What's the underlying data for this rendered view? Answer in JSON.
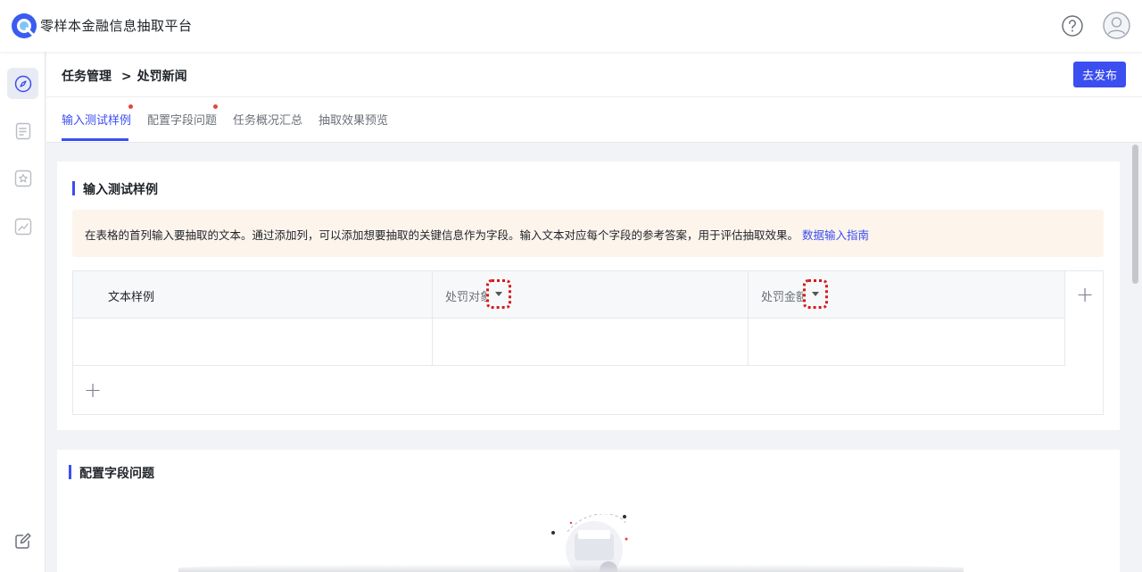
{
  "app": {
    "title": "零样本金融信息抽取平台"
  },
  "header": {
    "breadcrumb_parent": "任务管理",
    "breadcrumb_sep": ">",
    "breadcrumb_current": "处罚新闻",
    "publish_label": "去发布"
  },
  "tabs": [
    {
      "label": "输入测试样例",
      "active": true,
      "badge": true
    },
    {
      "label": "配置字段问题",
      "active": false,
      "badge": true
    },
    {
      "label": "任务概况汇总",
      "active": false,
      "badge": false
    },
    {
      "label": "抽取效果预览",
      "active": false,
      "badge": false
    }
  ],
  "section1": {
    "title": "输入测试样例",
    "notice_text": "在表格的首列输入要抽取的文本。通过添加列，可以添加想要抽取的关键信息作为字段。输入文本对应每个字段的参考答案，用于评估抽取效果。",
    "notice_link": "数据输入指南",
    "table": {
      "columns": [
        "文本样例",
        "处罚对象",
        "处罚金额"
      ],
      "add_column_label": "+",
      "add_row_label": "+"
    }
  },
  "section2": {
    "title": "配置字段问题"
  },
  "colors": {
    "accent": "#3b4ef0",
    "badge": "#e5453f",
    "notice_bg": "#fdf4ec",
    "highlight": "#d61b1b"
  },
  "icons": {
    "logo": "logo-q-icon",
    "help": "question-icon",
    "avatar": "user-avatar-icon",
    "nav": [
      "compass-icon",
      "document-icon",
      "star-icon",
      "chart-icon",
      "edit-icon"
    ]
  }
}
